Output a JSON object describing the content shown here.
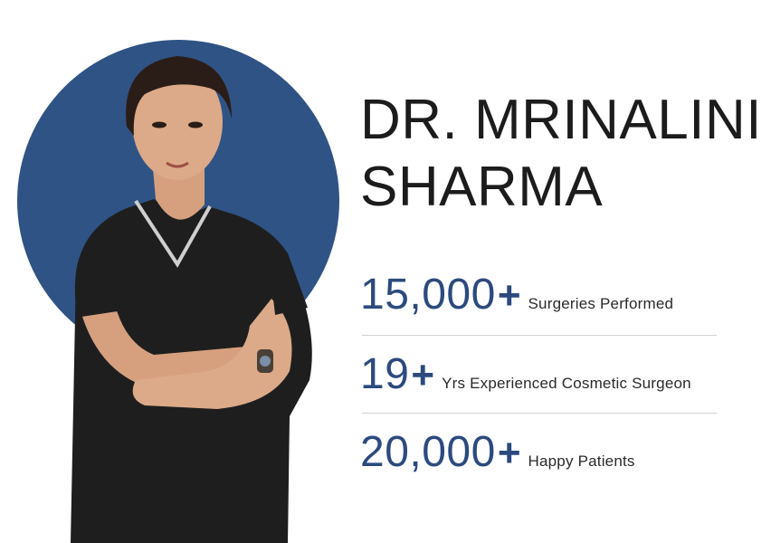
{
  "colors": {
    "accent": "#2c4a7e",
    "circle": "#2f5385",
    "text_dark": "#1c1c1c",
    "divider": "#d0d0d0"
  },
  "profile": {
    "name_line1": "DR. MRINALINI",
    "name_line2": "SHARMA",
    "photo": "doctor-portrait"
  },
  "stats": [
    {
      "number": "15,000",
      "plus": "+",
      "label": "Surgeries Performed"
    },
    {
      "number": "19",
      "plus": "+",
      "label": "Yrs Experienced Cosmetic Surgeon"
    },
    {
      "number": "20,000",
      "plus": "+",
      "label": "Happy Patients"
    }
  ]
}
